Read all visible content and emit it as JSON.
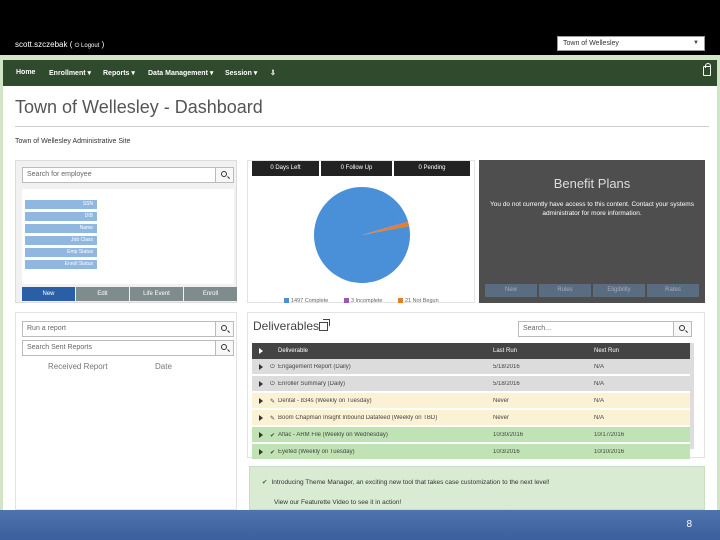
{
  "header": {
    "user": "scott.szczebak (",
    "logout": "Logout",
    "user_close": ")",
    "town_selector": "Town of Wellesley"
  },
  "nav": {
    "items": [
      {
        "label": "Home"
      },
      {
        "label": "Enrollment ▾"
      },
      {
        "label": "Reports ▾"
      },
      {
        "label": "Data Management ▾"
      },
      {
        "label": "Session ▾"
      }
    ]
  },
  "page": {
    "title": "Town of Wellesley - Dashboard",
    "site_label": "Town of Wellesley Administrative Site"
  },
  "employee_panel": {
    "search_placeholder": "Search for employee",
    "filters": [
      "SSN",
      "DIB",
      "Name",
      "Job Class",
      "Emp Status",
      "Enroll Status"
    ],
    "actions": [
      {
        "label": "New",
        "color": "#2a5fa8"
      },
      {
        "label": "Edit",
        "color": "#7f8c8d"
      },
      {
        "label": "Life Event",
        "color": "#7f8c8d"
      },
      {
        "label": "Enroll",
        "color": "#7f8c8d"
      }
    ]
  },
  "status_panel": {
    "stats": [
      "0 Days Left",
      "0 Follow Up",
      "0 Pending"
    ],
    "legend": [
      {
        "label": "1497 Complete",
        "color": "#4a90d9"
      },
      {
        "label": "3 Incomplete",
        "color": "#9b59b6"
      },
      {
        "label": "21 Not Begun",
        "color": "#e67e22"
      }
    ],
    "chart_data": {
      "type": "pie",
      "categories": [
        "Complete",
        "Incomplete",
        "Not Begun"
      ],
      "values": [
        1497,
        3,
        21
      ],
      "colors": [
        "#4a90d9",
        "#9b59b6",
        "#e67e22"
      ]
    }
  },
  "benefit_plans": {
    "title": "Benefit Plans",
    "message": "You do not currently have access to this content. Contact your systems administrator for more information.",
    "buttons": [
      "New",
      "Rules",
      "Eligibility",
      "Rates"
    ]
  },
  "reports_panel": {
    "run_placeholder": "Run a report",
    "sent_placeholder": "Search Sent Reports",
    "col_received": "Received Report",
    "col_date": "Date"
  },
  "deliverables": {
    "title": "Deliverables",
    "search_placeholder": "Search...",
    "columns": [
      "Deliverable",
      "Last Run",
      "Next Run"
    ],
    "rows": [
      {
        "icon": "⏻",
        "name": "Engagement Report (Daily)",
        "last": "5/18/2016",
        "next": "N/A",
        "bg": "#dcdcdc"
      },
      {
        "icon": "⏻",
        "name": "Enroller Summary (Daily)",
        "last": "5/18/2016",
        "next": "N/A",
        "bg": "#dcdcdc"
      },
      {
        "icon": "✎",
        "name": "Dental - 834s (Weekly on Tuesday)",
        "last": "Never",
        "next": "N/A",
        "bg": "#fbf2d6"
      },
      {
        "icon": "✎",
        "name": "Boom Chapman Insight Inbound Datafeed (Weekly on TBD)",
        "last": "Never",
        "next": "N/A",
        "bg": "#fbf2d6"
      },
      {
        "icon": "✔",
        "name": "Aflac - ARM File (Weekly on Wednesday)",
        "last": "10/30/2016",
        "next": "10/17/2016",
        "bg": "#bfe3b4"
      },
      {
        "icon": "✔",
        "name": "Eyefed (Weekly on Tuesday)",
        "last": "10/3/2016",
        "next": "10/10/2016",
        "bg": "#bfe3b4"
      }
    ]
  },
  "news": {
    "text": "Introducing Theme Manager, an exciting new tool that takes case customization to the next level!",
    "sub": "View our Featurette Video to see it in action!"
  },
  "footer": {
    "page_number": "8"
  }
}
